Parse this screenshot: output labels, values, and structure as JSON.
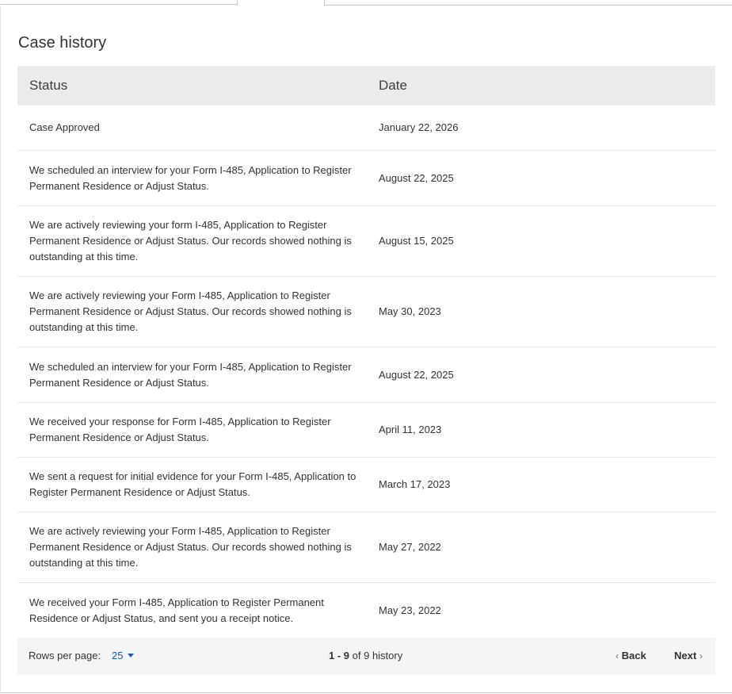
{
  "panel": {
    "title": "Case history"
  },
  "table": {
    "headers": {
      "status": "Status",
      "date": "Date"
    },
    "rows": [
      {
        "status": "Case Approved",
        "date": "January 22, 2026"
      },
      {
        "status": "We scheduled an interview for your Form I-485, Application to Register Permanent Residence or Adjust Status.",
        "date": "August 22, 2025"
      },
      {
        "status": "We are actively reviewing your form I-485, Application to Register Permanent Residence or Adjust Status. Our records showed nothing is outstanding at this time.",
        "date": "August 15, 2025"
      },
      {
        "status": "We are actively reviewing your Form I-485, Application to Register Permanent Residence or Adjust Status. Our records showed nothing is outstanding at this time.",
        "date": "May 30, 2023"
      },
      {
        "status": "We scheduled an interview for your Form I-485, Application to Register Permanent Residence or Adjust Status.",
        "date": "August 22, 2025"
      },
      {
        "status": "We received your response for Form I-485, Application to Register Permanent Residence or Adjust Status.",
        "date": "April 11, 2023"
      },
      {
        "status": "We sent a request for initial evidence for your Form I-485, Application to Register Permanent Residence or Adjust Status.",
        "date": "March 17, 2023"
      },
      {
        "status": "We are actively reviewing your Form I-485, Application to Register Permanent Residence or Adjust Status. Our records showed nothing is outstanding at this time.",
        "date": "May 27, 2022"
      },
      {
        "status": "We received your Form I-485, Application to Register Permanent Residence or Adjust Status, and sent you a receipt notice.",
        "date": "May 23, 2022"
      }
    ]
  },
  "footer": {
    "rows_per_page_label": "Rows per page:",
    "rows_per_page_value": "25",
    "range_start": "1",
    "range_sep": " - ",
    "range_end": "9",
    "range_suffix": " of 9 history",
    "back_label": "Back",
    "next_label": "Next",
    "back_icon": "chevron-left-icon",
    "next_icon": "chevron-right-icon",
    "select_icon": "caret-down-icon"
  },
  "colors": {
    "header_bg": "#ebebeb",
    "footer_bg": "#f5f5f5",
    "link": "#1a5da6",
    "row_divider": "#e8e8e8"
  }
}
